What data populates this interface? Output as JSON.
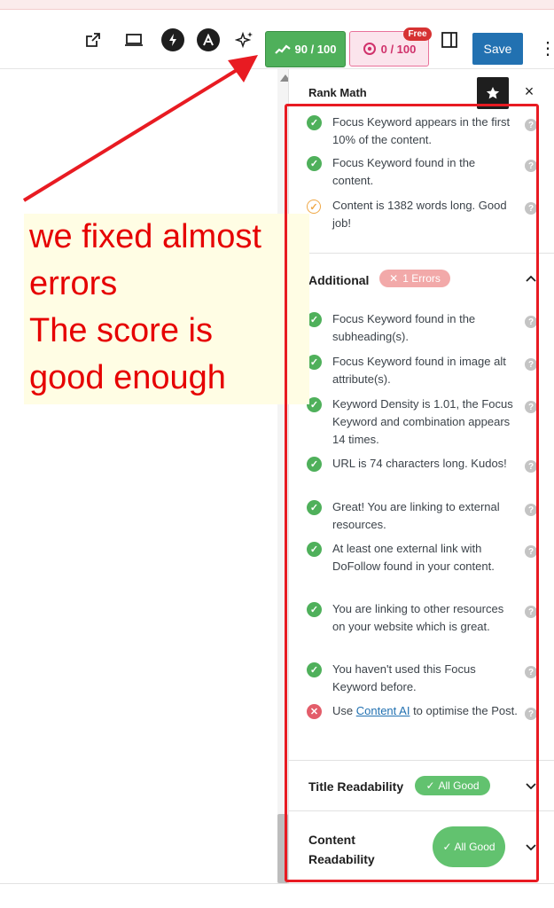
{
  "toolbar": {
    "icons": [
      "external-link-icon",
      "desktop-preview-icon",
      "lightning-icon",
      "astra-logo-icon",
      "ai-sparkle-icon",
      "sidebar-toggle-icon",
      "more-options-icon"
    ],
    "seo_score": "90 / 100",
    "content_ai_score": "0 / 100",
    "free_badge": "Free",
    "save_label": "Save",
    "colors": {
      "score_good": "#4fb05b",
      "score_ai": "#d0326b",
      "save": "#2271b1"
    }
  },
  "panel": {
    "title": "Rank Math",
    "top_items": [
      {
        "status": "ok",
        "text": "Focus Keyword appears in the first 10% of the content."
      },
      {
        "status": "ok",
        "text": "Focus Keyword found in the content."
      },
      {
        "status": "warn",
        "text": "Content is 1382 words long. Good job!"
      }
    ],
    "additional": {
      "title": "Additional",
      "badge": "1 Errors",
      "items": [
        {
          "status": "ok",
          "text": "Focus Keyword found in the subheading(s)."
        },
        {
          "status": "ok",
          "text": "Focus Keyword found in image alt attribute(s)."
        },
        {
          "status": "ok",
          "text": "Keyword Density is 1.01, the Focus Keyword and combination appears 14 times."
        },
        {
          "status": "ok",
          "text": "URL is 74 characters long. Kudos!"
        },
        {
          "status": "ok",
          "text": "Great! You are linking to external resources."
        },
        {
          "status": "ok",
          "text": "At least one external link with DoFollow found in your content."
        },
        {
          "status": "ok",
          "text": "You are linking to other resources on your website which is great."
        },
        {
          "status": "ok",
          "text": "You haven't used this Focus Keyword before."
        },
        {
          "status": "error",
          "prefix": "Use ",
          "link": "Content AI",
          "suffix": " to optimise the Post."
        }
      ]
    },
    "title_readability": {
      "title": "Title Readability",
      "badge": "All Good"
    },
    "content_readability": {
      "title": "Content Readability",
      "badge": "All Good"
    }
  },
  "annotation": {
    "text_line1": "we fixed almost",
    "text_line2": "errors",
    "text_line3": "The score is",
    "text_line4": "good enough",
    "color": "#e60000"
  }
}
